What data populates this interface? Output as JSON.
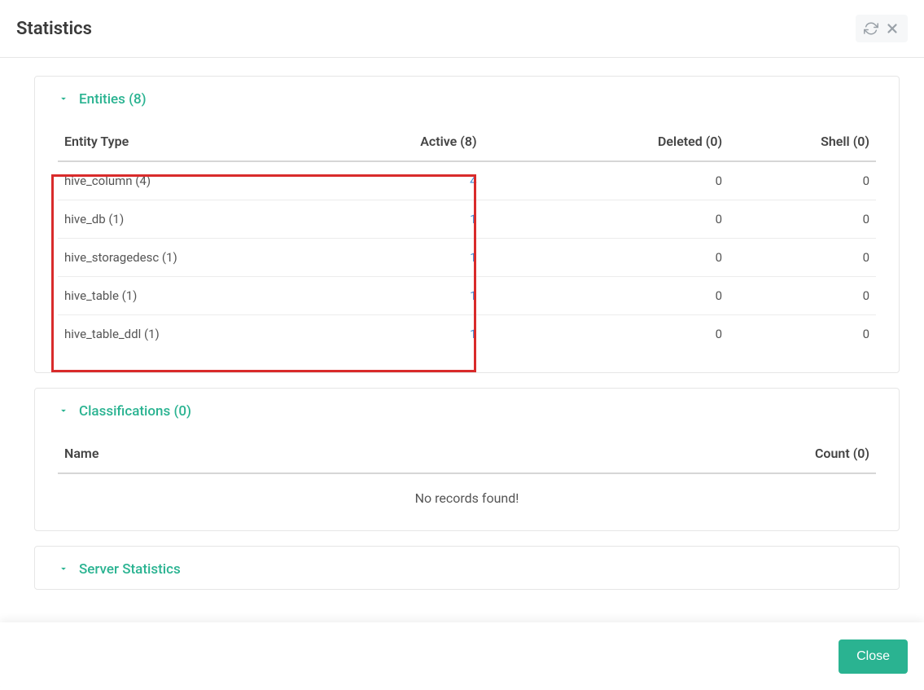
{
  "modal": {
    "title": "Statistics",
    "close_button": "Close"
  },
  "entities_panel": {
    "title": "Entities  (8)",
    "columns": {
      "entity_type": "Entity Type",
      "active": "Active  (8)",
      "deleted": "Deleted  (0)",
      "shell": "Shell  (0)"
    },
    "rows": [
      {
        "type": "hive_column (4)",
        "active": "4",
        "deleted": "0",
        "shell": "0"
      },
      {
        "type": "hive_db (1)",
        "active": "1",
        "deleted": "0",
        "shell": "0"
      },
      {
        "type": "hive_storagedesc (1)",
        "active": "1",
        "deleted": "0",
        "shell": "0"
      },
      {
        "type": "hive_table (1)",
        "active": "1",
        "deleted": "0",
        "shell": "0"
      },
      {
        "type": "hive_table_ddl (1)",
        "active": "1",
        "deleted": "0",
        "shell": "0"
      }
    ]
  },
  "classifications_panel": {
    "title": "Classifications (0)",
    "columns": {
      "name": "Name",
      "count": "Count (0)"
    },
    "no_records": "No records found!"
  },
  "server_stats_panel": {
    "title": "Server Statistics"
  }
}
